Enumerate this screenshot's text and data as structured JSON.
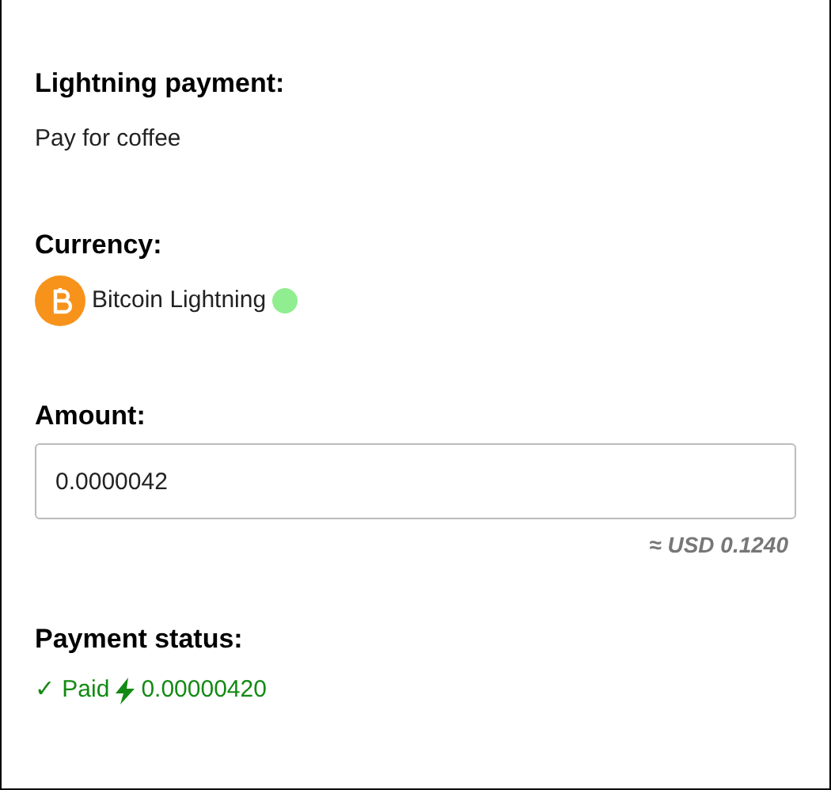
{
  "payment": {
    "heading": "Lightning payment:",
    "description": "Pay for coffee"
  },
  "currency": {
    "heading": "Currency:",
    "name": "Bitcoin Lightning",
    "status_dot": {
      "color": "#90ee90"
    }
  },
  "amount": {
    "heading": "Amount:",
    "value": "0.0000042",
    "conversion": "≈ USD 0.1240"
  },
  "status": {
    "heading": "Payment status:",
    "paid": true,
    "label": "✓ Paid",
    "amount": "0.00000420"
  }
}
